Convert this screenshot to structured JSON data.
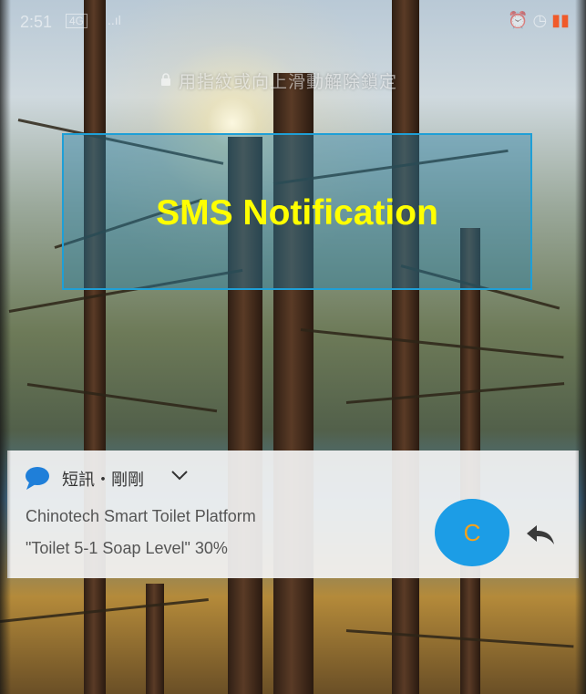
{
  "status_bar": {
    "time": "2:51",
    "network": "4G",
    "signal": "..ıl",
    "icons": "⏰ ◷",
    "battery": "▮▮"
  },
  "lock_screen": {
    "unlock_hint": "用指紋或向上滑動解除鎖定"
  },
  "overlay": {
    "title": "SMS Notification",
    "text_color": "#ffff00",
    "border_color": "#1f9fd6"
  },
  "notification": {
    "app_icon": "chat-bubble-icon",
    "header": "短訊・剛剛",
    "sender": "Chinotech Smart Toilet Platform",
    "message": "\"Toilet 5-1 Soap Level\" 30%",
    "avatar_letter": "C",
    "avatar_color": "#1c9de6",
    "reply_icon": "reply-arrow-icon"
  }
}
